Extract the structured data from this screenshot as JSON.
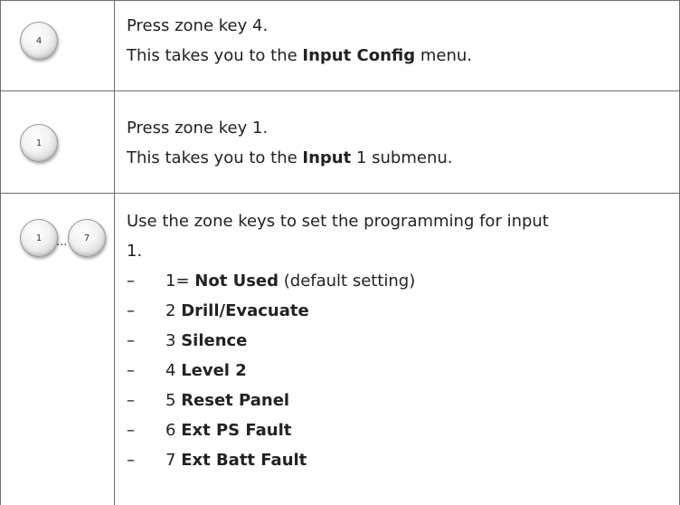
{
  "rows": [
    {
      "keys": [
        "4"
      ],
      "line1": "Press zone key 4.",
      "line2_pre": "This takes you to the ",
      "line2_bold": "Input Config",
      "line2_post": " menu."
    },
    {
      "keys": [
        "1"
      ],
      "line1": "Press zone key 1.",
      "line2_pre": "This takes you to the ",
      "line2_bold": "Input",
      "line2_post": " 1 submenu."
    },
    {
      "keys": [
        "1",
        "7"
      ],
      "separator": "...",
      "line1": "Use the zone keys to set the programming for input",
      "line2": "1.",
      "dash": "–",
      "options": [
        {
          "num": "1=",
          "label": "Not Used",
          "note": "(default setting)"
        },
        {
          "num": "2",
          "label": "Drill/Evacuate"
        },
        {
          "num": "3",
          "label": "Silence"
        },
        {
          "num": "4",
          "label": "Level 2"
        },
        {
          "num": "5",
          "label": "Reset Panel"
        },
        {
          "num": "6",
          "label": "Ext PS Fault"
        },
        {
          "num": "7",
          "label": "Ext Batt Fault"
        }
      ]
    }
  ]
}
